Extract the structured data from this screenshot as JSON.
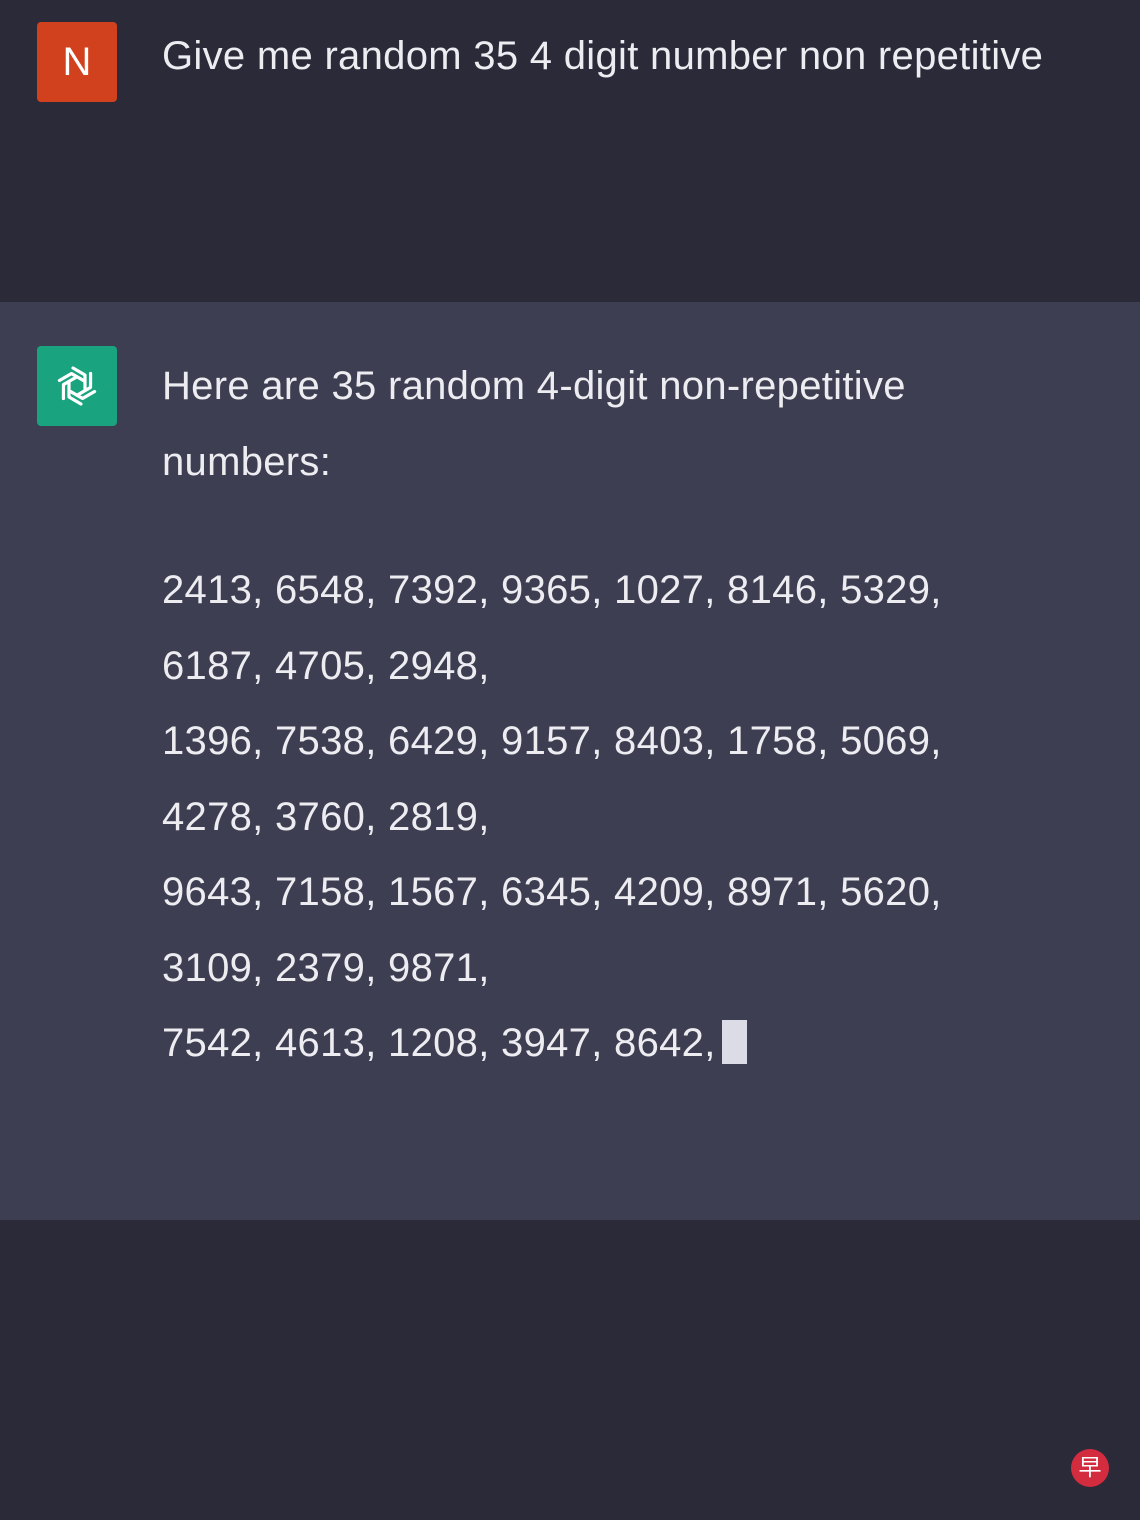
{
  "user": {
    "avatar_letter": "N",
    "avatar_color": "#d2411d",
    "message": "Give me random 35 4 digit number non repetitive"
  },
  "assistant": {
    "avatar_icon": "openai-logo-icon",
    "avatar_color": "#19a37f",
    "intro": "Here are 35 random 4-digit non-repetitive numbers:",
    "number_lines": [
      "2413, 6548, 7392, 9365, 1027, 8146, 5329,",
      "6187, 4705, 2948,",
      "1396, 7538, 6429, 9157, 8403, 1758, 5069,",
      "4278, 3760, 2819,",
      "9643, 7158, 1567, 6345, 4209, 8971, 5620,",
      "3109, 2379, 9871,",
      "7542, 4613, 1208, 3947, 8642,"
    ],
    "streaming_cursor_visible": true
  },
  "watermark": {
    "text": "早",
    "color": "#d42c3f"
  },
  "colors": {
    "background": "#2a2a39",
    "assistant_background": "#3e3e52",
    "text": "#ececf1"
  }
}
